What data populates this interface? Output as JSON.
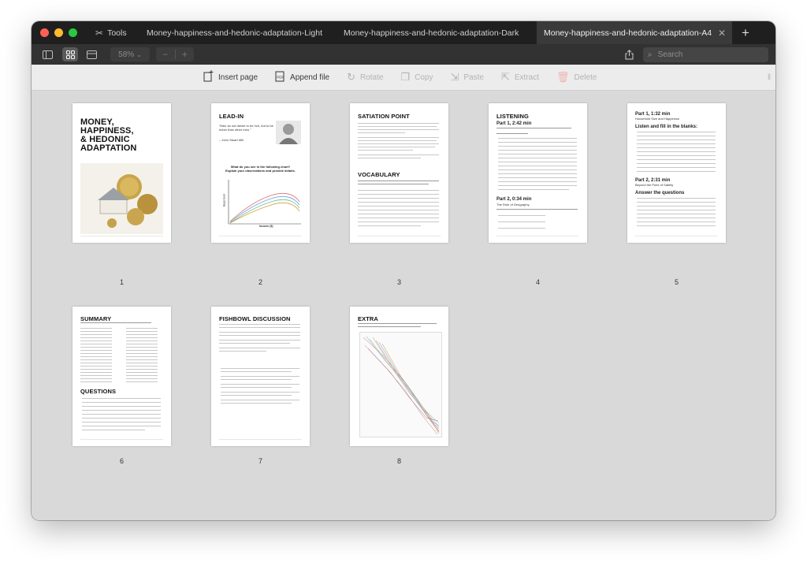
{
  "window": {
    "tabs": [
      {
        "label": "Tools",
        "icon": "tools-icon"
      },
      {
        "label": "Money-happiness-and-hedonic-adaptation-Light"
      },
      {
        "label": "Money-happiness-and-hedonic-adaptation-Dark"
      },
      {
        "label": "Money-happiness-and-hedonic-adaptation-A4",
        "active": true
      }
    ]
  },
  "toolbar": {
    "zoom": "58%",
    "search_placeholder": "Search"
  },
  "actions": {
    "insert_page": "Insert page",
    "append_file": "Append file",
    "rotate": "Rotate",
    "copy": "Copy",
    "paste": "Paste",
    "extract": "Extract",
    "delete": "Delete"
  },
  "pages": [
    {
      "number": "1",
      "title": "MONEY,\nHAPPINESS,\n& HEDONIC\nADAPTATION"
    },
    {
      "number": "2",
      "title": "LEAD-IN",
      "quote": "\"Men do not desire to be rich, but to be richer than other men.\"",
      "author": "– John Stuart Mill",
      "caption": "What do you see in the following chart?\nExplain your observations and provide details.",
      "ylabel": "Happiness",
      "xlabel": "Income ($)"
    },
    {
      "number": "3",
      "title": "SATIATION POINT",
      "title2": "VOCABULARY"
    },
    {
      "number": "4",
      "title": "LISTENING",
      "part1": "Part 1, 2:42 min",
      "part2": "Part 2, 0:34 min",
      "sub2": "The Role of Geography"
    },
    {
      "number": "5",
      "part1": "Part 1, 1:32 min",
      "sub1": "Household Size and Happiness",
      "listen": "Listen and fill in the blanks:",
      "part2": "Part 2, 2:31 min",
      "sub2": "Beyond the Point of Satiety",
      "answer": "Answer the questions"
    },
    {
      "number": "6",
      "title": "SUMMARY",
      "title2": "QUESTIONS"
    },
    {
      "number": "7",
      "title": "FISHBOWL DISCUSSION"
    },
    {
      "number": "8",
      "title": "EXTRA"
    }
  ]
}
